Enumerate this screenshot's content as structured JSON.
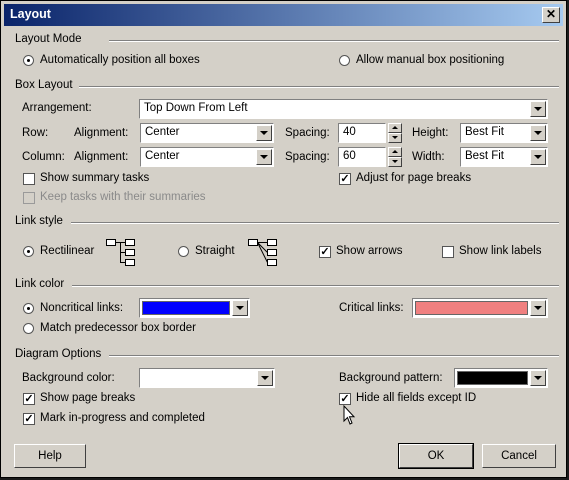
{
  "window": {
    "title": "Layout",
    "close_glyph": "✕"
  },
  "layout_mode": {
    "section_label": "Layout Mode",
    "auto_label": "Automatically position all boxes",
    "manual_label": "Allow manual box positioning",
    "selected": "auto"
  },
  "box_layout": {
    "section_label": "Box Layout",
    "arrangement_label": "Arrangement:",
    "arrangement_value": "Top Down From Left",
    "row_label": "Row:",
    "column_label": "Column:",
    "alignment_label": "Alignment:",
    "spacing_label": "Spacing:",
    "height_label": "Height:",
    "width_label": "Width:",
    "row_alignment": "Center",
    "row_spacing": "40",
    "row_height": "Best Fit",
    "column_alignment": "Center",
    "column_spacing": "60",
    "column_width": "Best Fit",
    "show_summary_label": "Show summary tasks",
    "show_summary_checked": false,
    "keep_tasks_label": "Keep tasks with their summaries",
    "keep_tasks_enabled": false,
    "adjust_breaks_label": "Adjust for page breaks",
    "adjust_breaks_checked": true
  },
  "link_style": {
    "section_label": "Link style",
    "rectilinear_label": "Rectilinear",
    "straight_label": "Straight",
    "selected": "rectilinear",
    "show_arrows_label": "Show arrows",
    "show_arrows_checked": true,
    "show_link_labels_label": "Show link labels",
    "show_link_labels_checked": false
  },
  "link_color": {
    "section_label": "Link color",
    "noncritical_label": "Noncritical links:",
    "noncritical_color": "#0000ff",
    "critical_label": "Critical links:",
    "critical_color": "#f08080",
    "match_predecessor_label": "Match predecessor box border",
    "selected": "noncritical"
  },
  "diagram_options": {
    "section_label": "Diagram Options",
    "background_color_label": "Background color:",
    "background_color": "#ffffff",
    "background_pattern_label": "Background pattern:",
    "background_pattern": "#000000",
    "show_page_breaks_label": "Show page breaks",
    "show_page_breaks_checked": true,
    "hide_fields_label": "Hide all fields except ID",
    "hide_fields_checked": true,
    "mark_progress_label": "Mark in-progress and completed",
    "mark_progress_checked": true
  },
  "buttons": {
    "help": "Help",
    "ok": "OK",
    "cancel": "Cancel"
  },
  "check_glyph": "✓"
}
